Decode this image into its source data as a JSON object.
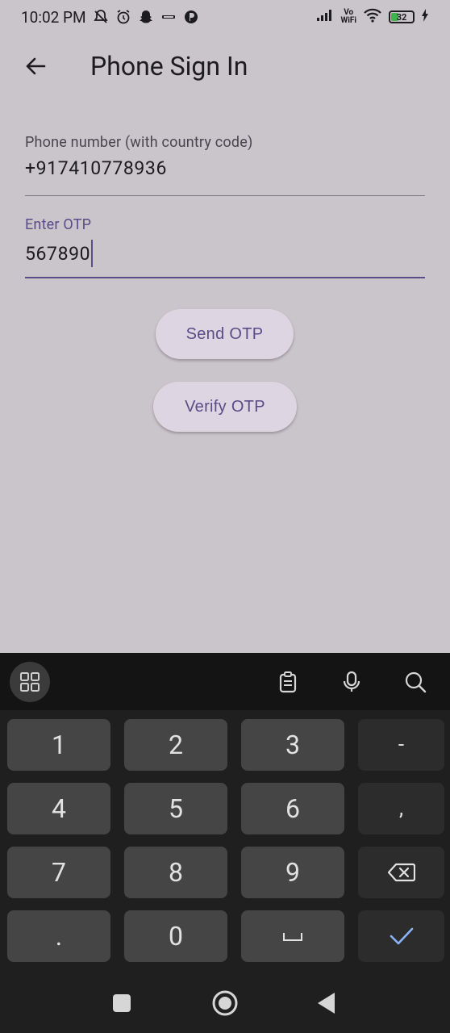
{
  "status_bar": {
    "time": "10:02 PM",
    "vo_label": "Vo",
    "wifi_label": "WiFi",
    "battery": "32",
    "icons": [
      "bell-off-icon",
      "alarm-icon",
      "snapchat-icon",
      "zomato-icon",
      "app-icon",
      "signal-icon",
      "wifi-icon",
      "battery-icon",
      "charging-icon"
    ]
  },
  "app_bar": {
    "title": "Phone Sign In",
    "back_icon": "arrow-left-icon"
  },
  "phone_field": {
    "label": "Phone number (with country code)",
    "value": "+917410778936"
  },
  "otp_field": {
    "label": "Enter OTP",
    "value": "567890"
  },
  "buttons": {
    "send_otp": "Send OTP",
    "verify_otp": "Verify OTP"
  },
  "keyboard": {
    "toolbar_icons": [
      "apps-grid-icon",
      "clipboard-icon",
      "microphone-icon",
      "search-icon"
    ],
    "keys": {
      "k1": "1",
      "k2": "2",
      "k3": "3",
      "dash": "-",
      "k4": "4",
      "k5": "5",
      "k6": "6",
      "comma": ",",
      "k7": "7",
      "k8": "8",
      "k9": "9",
      "dot": ".",
      "k0": "0"
    },
    "special_icons": [
      "backspace-icon",
      "space-icon",
      "checkmark-icon"
    ]
  },
  "nav_bar": {
    "icons": [
      "recents-square-icon",
      "home-circle-icon",
      "back-triangle-icon"
    ]
  },
  "colors": {
    "background": "#cac4cb",
    "accent": "#5b4c8a",
    "button_bg": "#ddd6e2",
    "keyboard_bg": "#1f1f1f",
    "key_bg": "#454545",
    "key_side_bg": "#2c2c2c",
    "check_color": "#8ab4f8"
  }
}
